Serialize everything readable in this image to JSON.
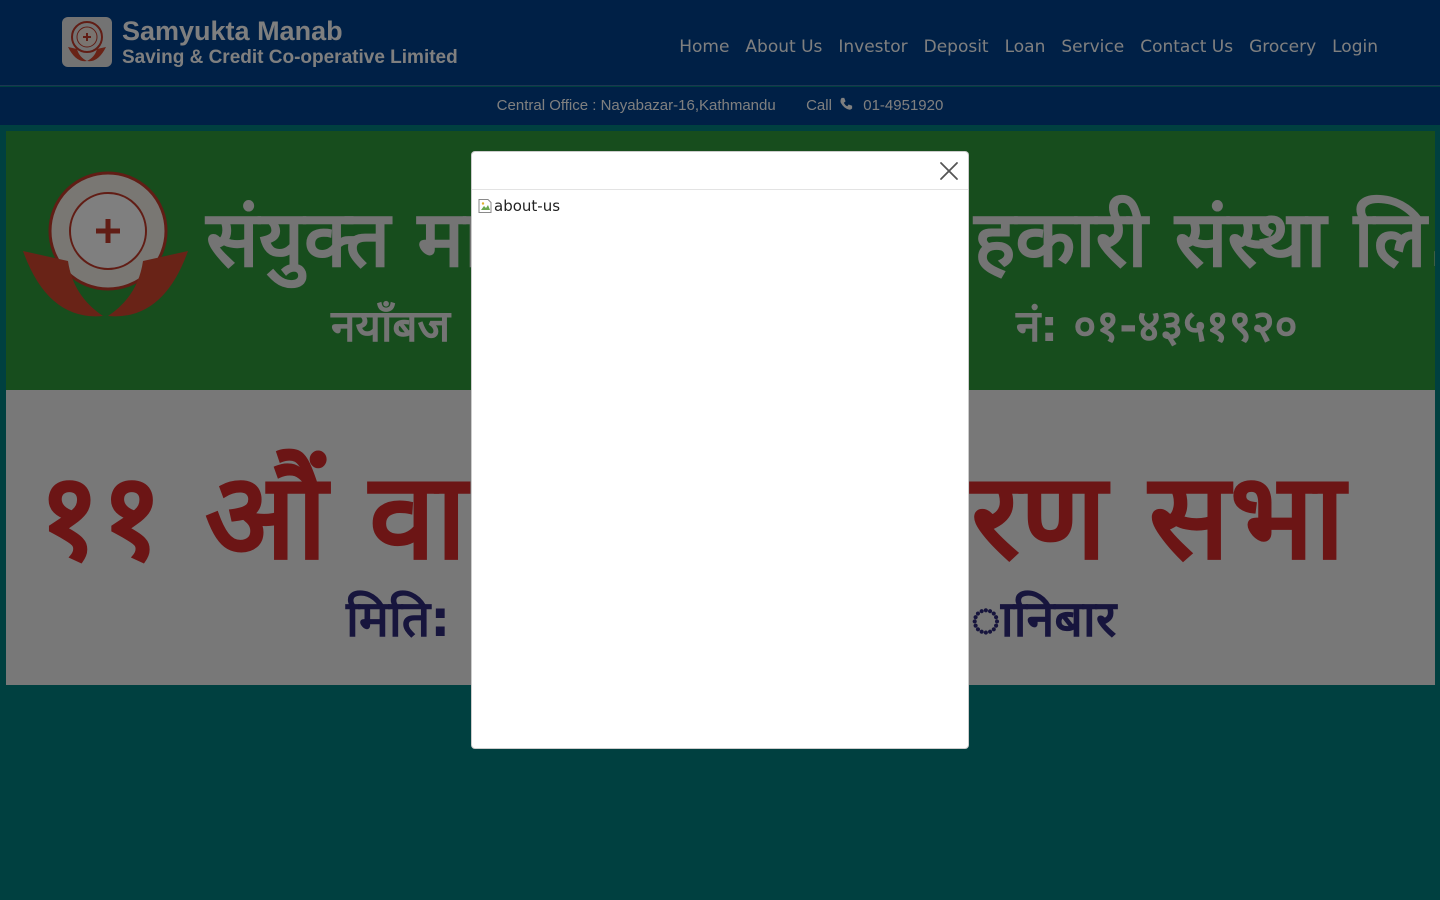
{
  "header": {
    "brand_title": "Samyukta Manab",
    "brand_subtitle": "Saving & Credit Co-operative Limited",
    "logo_icon": "cooperative-hands-logo",
    "nav": [
      {
        "label": "Home"
      },
      {
        "label": "About Us"
      },
      {
        "label": "Investor"
      },
      {
        "label": "Deposit"
      },
      {
        "label": "Loan"
      },
      {
        "label": "Service"
      },
      {
        "label": "Contact Us"
      },
      {
        "label": "Grocery"
      },
      {
        "label": "Login"
      }
    ]
  },
  "infobar": {
    "office": "Central Office : Nayabazar-16,Kathmandu",
    "call_label": "Call",
    "phone": "01-4951920"
  },
  "banner": {
    "title": "संयुक्त मान",
    "title_right": "हकारी संस्था लि.",
    "address": "नयाँबज",
    "phone": "नं: ०१-४३५१९२०",
    "agm": "११ औं वा",
    "agm_right": "रण सभा",
    "date": "मिति: ",
    "day": "ानिबार"
  },
  "modal": {
    "image_alt": "about-us",
    "close_icon": "close-icon"
  },
  "colors": {
    "page_bg": "#008080",
    "header_bg": "#00408c",
    "banner_green": "#2e9a3b",
    "banner_red": "#d92b2b"
  }
}
